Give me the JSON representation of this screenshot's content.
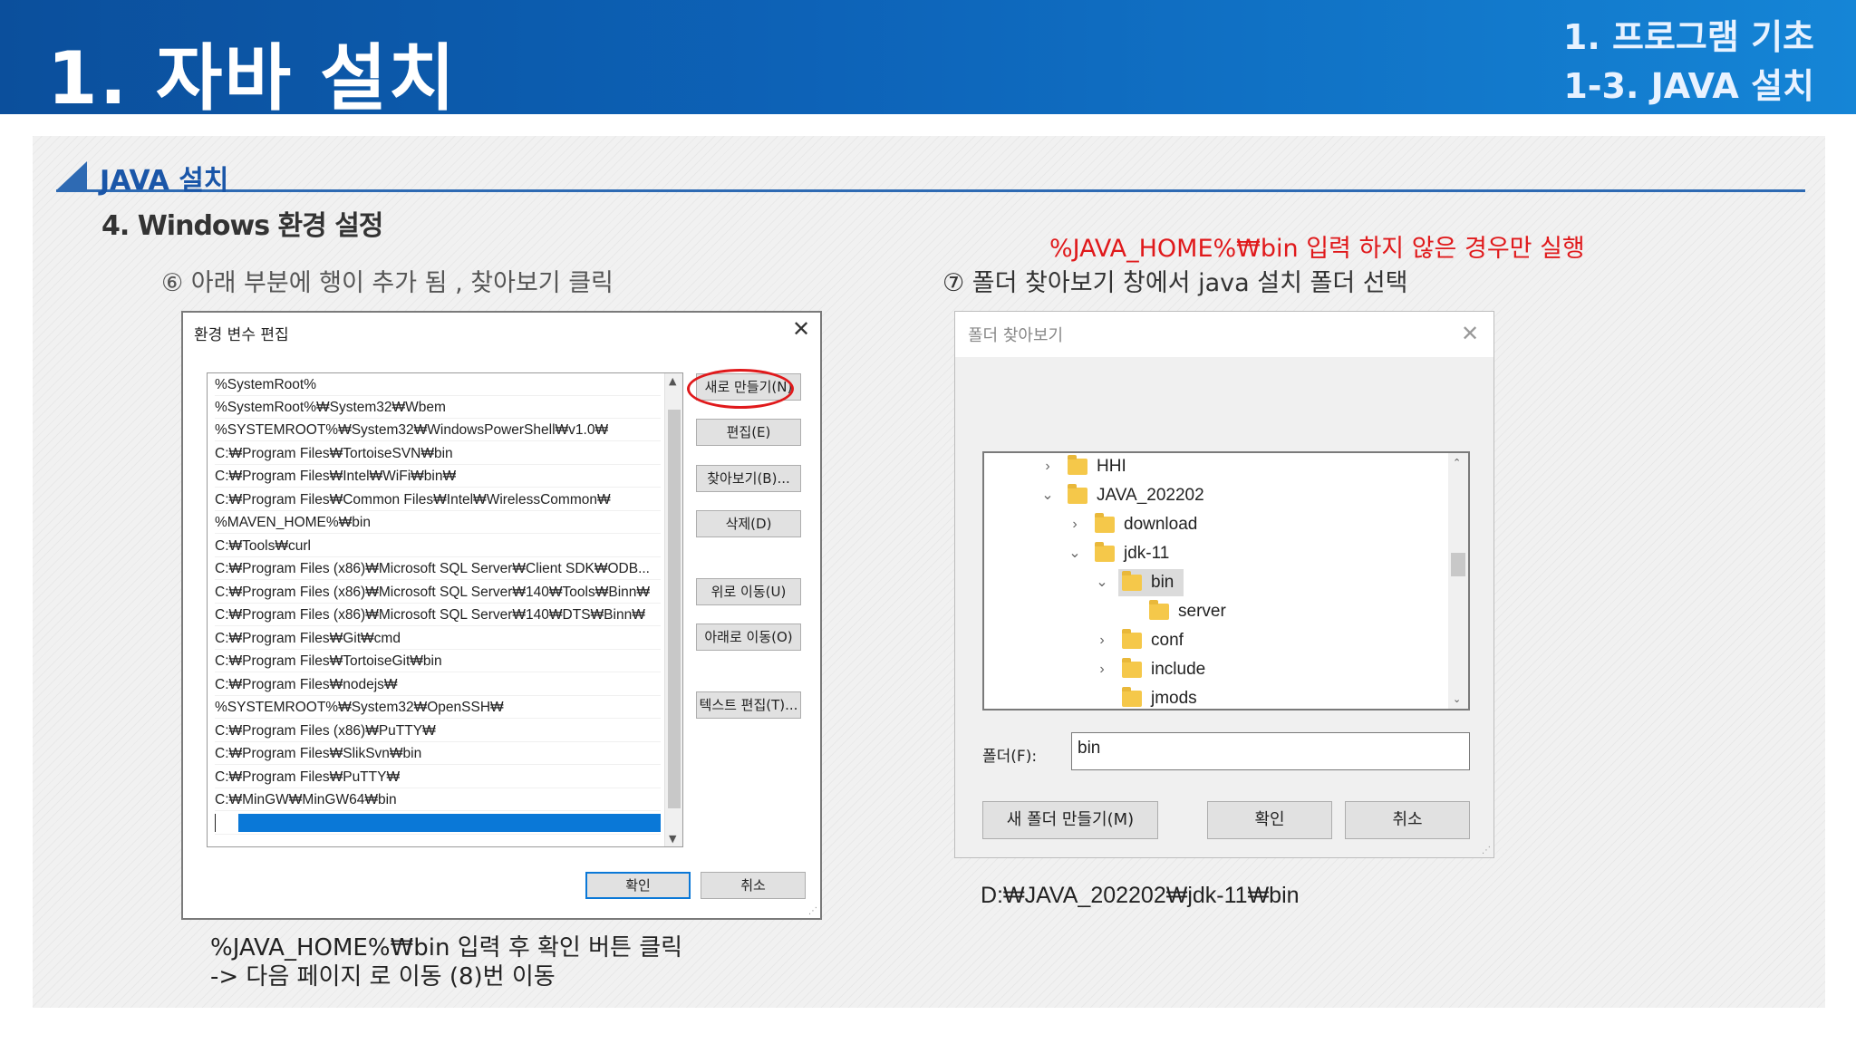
{
  "header": {
    "title": "1. 자바 설치",
    "crumb_top": "1. 프로그램 기초",
    "crumb_bottom": "1-3. JAVA 설치"
  },
  "section": {
    "label": "JAVA 설치"
  },
  "step_title": "4.  Windows  환경 설정",
  "sub_left": "⑥ 아래 부분에 행이 추가 됨 , 찾아보기 클릭",
  "sub_right": "⑦ 폴더 찾아보기 창에서 java 설치 폴더 선택",
  "note_red": "%JAVA_HOME%₩bin 입력 하지 않은 경우만 실행",
  "env_dialog": {
    "title": "환경 변수 편집",
    "close": "✕",
    "rows": [
      "%SystemRoot%",
      "%SystemRoot%₩System32₩Wbem",
      "%SYSTEMROOT%₩System32₩WindowsPowerShell₩v1.0₩",
      "C:₩Program Files₩TortoiseSVN₩bin",
      "C:₩Program Files₩Intel₩WiFi₩bin₩",
      "C:₩Program Files₩Common Files₩Intel₩WirelessCommon₩",
      "%MAVEN_HOME%₩bin",
      "C:₩Tools₩curl",
      "C:₩Program Files (x86)₩Microsoft SQL Server₩Client SDK₩ODB...",
      "C:₩Program Files (x86)₩Microsoft SQL Server₩140₩Tools₩Binn₩",
      "C:₩Program Files (x86)₩Microsoft SQL Server₩140₩DTS₩Binn₩",
      "C:₩Program Files₩Git₩cmd",
      "C:₩Program Files₩TortoiseGit₩bin",
      "C:₩Program Files₩nodejs₩",
      "%SYSTEMROOT%₩System32₩OpenSSH₩",
      "C:₩Program Files (x86)₩PuTTY₩",
      "C:₩Program Files₩SlikSvn₩bin",
      "C:₩Program Files₩PuTTY₩",
      "C:₩MinGW₩MinGW64₩bin"
    ],
    "buttons": {
      "new": "새로 만들기(N)",
      "edit": "편집(E)",
      "browse": "찾아보기(B)...",
      "delete": "삭제(D)",
      "up": "위로 이동(U)",
      "down": "아래로 이동(O)",
      "text_edit": "텍스트 편집(T)...",
      "ok": "확인",
      "cancel": "취소"
    }
  },
  "folder_dialog": {
    "title": "폴더 찾아보기",
    "close": "✕",
    "tree": [
      {
        "label": "HHI",
        "chevron": "›"
      },
      {
        "label": "JAVA_202202",
        "chevron": "⌄"
      },
      {
        "label": "download",
        "chevron": "›"
      },
      {
        "label": "jdk-11",
        "chevron": "⌄"
      },
      {
        "label": "bin",
        "chevron": "⌄"
      },
      {
        "label": "server",
        "chevron": ""
      },
      {
        "label": "conf",
        "chevron": "›"
      },
      {
        "label": "include",
        "chevron": "›"
      },
      {
        "label": "jmods",
        "chevron": ""
      }
    ],
    "folder_label": "폴더(F):",
    "folder_value": "bin",
    "buttons": {
      "new_folder": "새 폴더 만들기(M)",
      "ok": "확인",
      "cancel": "취소"
    }
  },
  "path_text": "D:₩JAVA_202202₩jdk-11₩bin",
  "bottom_note": {
    "line1": "%JAVA_HOME%₩bin 입력 후 확인 버튼 클릭",
    "line2": "-> 다음 페이지 로 이동 (8)번 이동"
  },
  "colors": {
    "header_blue": "#0d63b8",
    "accent_red": "#e0191b",
    "selection_blue": "#0a78d7"
  }
}
